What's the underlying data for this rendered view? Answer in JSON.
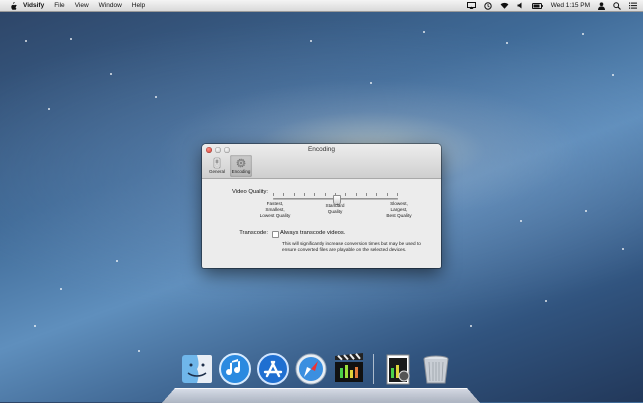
{
  "menubar": {
    "app_name": "Vidsify",
    "items": [
      "File",
      "View",
      "Window",
      "Help"
    ],
    "clock": "Wed 1:15 PM"
  },
  "window": {
    "title": "Encoding",
    "toolbar": [
      {
        "label": "General",
        "icon": "switch-icon",
        "selected": false
      },
      {
        "label": "Encoding",
        "icon": "gear-icon",
        "selected": true
      }
    ],
    "video_quality": {
      "label": "Video Quality:",
      "position": 0.5,
      "left_label": "Fastest,\nSmallest,\nLowest Quality",
      "middle_label": "Standard\nQuality",
      "right_label": "Slowest,\nLargest,\nBest Quality"
    },
    "transcode": {
      "label": "Transcode:",
      "checkbox_label": "Always transcode videos.",
      "checked": false,
      "note": "This will significantly increase conversion times but may be used to ensure converted files are playable on the selected devices."
    }
  },
  "dock": {
    "icons": [
      "finder-icon",
      "itunes-icon",
      "app-store-icon",
      "safari-icon",
      "vidsify-icon",
      "documents-stack-icon",
      "trash-icon"
    ]
  },
  "colors": {
    "close_button": "#d0352a",
    "dock_blue": "#1f6fd1"
  }
}
